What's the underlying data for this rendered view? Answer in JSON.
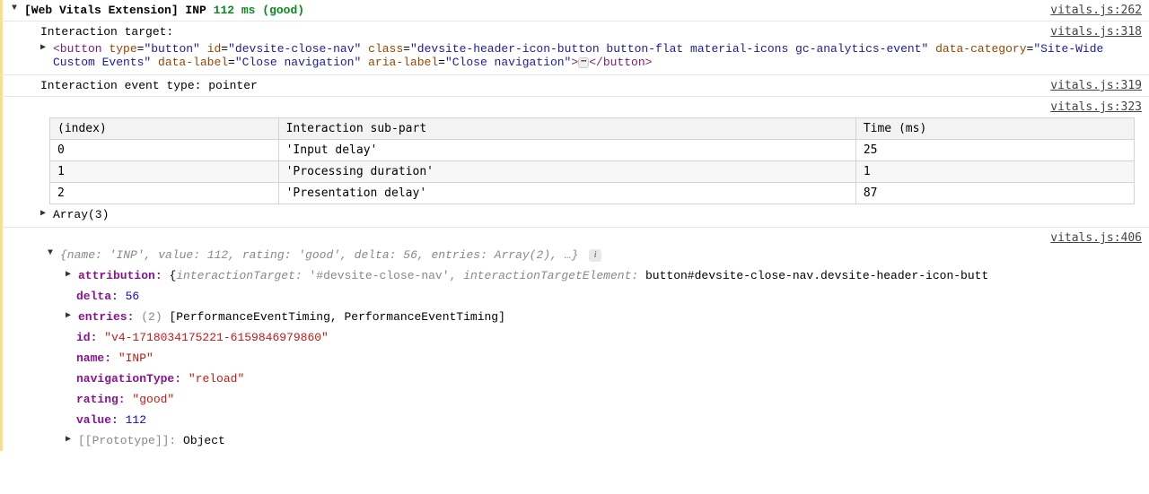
{
  "header": {
    "title": "[Web Vitals Extension] INP",
    "value": "112 ms",
    "rating": "(good)",
    "source": "vitals.js:262"
  },
  "interactionTarget": {
    "label": "Interaction target:",
    "source": "vitals.js:318",
    "tag": "button",
    "closeText": "</button>",
    "attrs": [
      {
        "name": "type",
        "value": "\"button\""
      },
      {
        "name": "id",
        "value": "\"devsite-close-nav\""
      },
      {
        "name": "class",
        "value": "\"devsite-header-icon-button button-flat material-icons gc-analytics-event\""
      },
      {
        "name": "data-category",
        "value": "\"Site-Wide Custom Events\""
      },
      {
        "name": "data-label",
        "value": "\"Close navigation\""
      },
      {
        "name": "aria-label",
        "value": "\"Close navigation\""
      }
    ]
  },
  "eventType": {
    "text": "Interaction event type: pointer",
    "source": "vitals.js:319"
  },
  "table": {
    "source": "vitals.js:323",
    "headers": [
      "(index)",
      "Interaction sub-part",
      "Time (ms)"
    ],
    "rows": [
      [
        "0",
        "'Input delay'",
        "25"
      ],
      [
        "1",
        "'Processing duration'",
        "1"
      ],
      [
        "2",
        "'Presentation delay'",
        "87"
      ]
    ],
    "arrayLabel": "Array(3)"
  },
  "object": {
    "source": "vitals.js:406",
    "summary": "{name: 'INP', value: 112, rating: 'good', delta: 56, entries: Array(2), …}",
    "attribution": {
      "key": "attribution:",
      "openBrace": "{",
      "interactionTargetKey": "interactionTarget:",
      "interactionTargetVal": "'#devsite-close-nav'",
      "interactionTargetElementKey": "interactionTargetElement:",
      "interactionTargetElementVal": "button#devsite-close-nav.devsite-header-icon-butt"
    },
    "delta": {
      "key": "delta:",
      "value": "56"
    },
    "entries": {
      "key": "entries:",
      "count": "(2)",
      "value": "[PerformanceEventTiming, PerformanceEventTiming]"
    },
    "id": {
      "key": "id:",
      "value": "\"v4-1718034175221-6159846979860\""
    },
    "name": {
      "key": "name:",
      "value": "\"INP\""
    },
    "navigationType": {
      "key": "navigationType:",
      "value": "\"reload\""
    },
    "rating": {
      "key": "rating:",
      "value": "\"good\""
    },
    "value": {
      "key": "value:",
      "value": "112"
    },
    "prototype": {
      "key": "[[Prototype]]:",
      "value": "Object"
    }
  },
  "chart_data": {
    "type": "table",
    "title": "INP Interaction sub-part breakdown",
    "columns": [
      "(index)",
      "Interaction sub-part",
      "Time (ms)"
    ],
    "rows": [
      {
        "index": 0,
        "sub_part": "Input delay",
        "time_ms": 25
      },
      {
        "index": 1,
        "sub_part": "Processing duration",
        "time_ms": 1
      },
      {
        "index": 2,
        "sub_part": "Presentation delay",
        "time_ms": 87
      }
    ]
  }
}
